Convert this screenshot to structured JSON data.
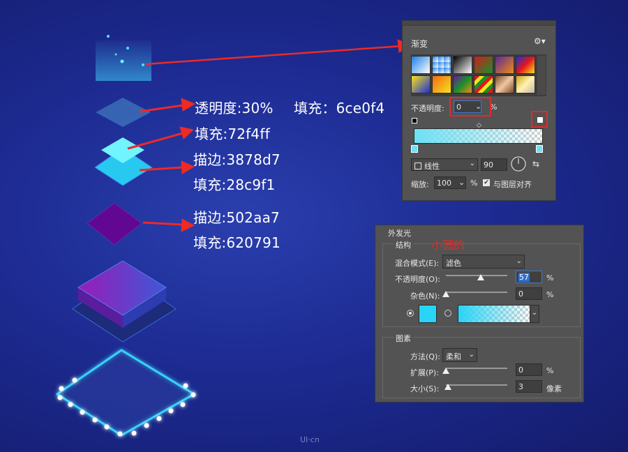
{
  "annotations": {
    "opacity_fill": "透明度:30%",
    "fill_top": "填充：6ce0f4",
    "fill_72": "填充:72f4ff",
    "stroke_38": "描边:3878d7",
    "fill_28": "填充:28c9f1",
    "stroke_50": "描边:502aa7",
    "fill_62": "填充:620791",
    "small_circle_note": "小圆的"
  },
  "gradient_panel": {
    "title": "渐变",
    "opacity_label": "不透明度:",
    "opacity_value": "0",
    "percent": "%",
    "style_value": "线性",
    "angle_value": "90",
    "scale_label": "缩放:",
    "scale_value": "100",
    "align_label": "与图层对齐",
    "colors": {
      "bar_start": "#6ce0f4"
    }
  },
  "glow_panel": {
    "title": "外发光",
    "structure_label": "结构",
    "blend_label": "混合模式(E):",
    "blend_value": "滤色",
    "opacity_label": "不透明度(O):",
    "opacity_value": "57",
    "noise_label": "杂色(N):",
    "noise_value": "0",
    "percent": "%",
    "elements_label": "图素",
    "method_label": "方法(Q):",
    "method_value": "柔和",
    "spread_label": "扩展(P):",
    "spread_value": "0",
    "size_label": "大小(S):",
    "size_value": "3",
    "pixels_unit": "像素",
    "colors": {
      "glow_color": "#28d4f7"
    }
  },
  "watermark": "UI·cn"
}
